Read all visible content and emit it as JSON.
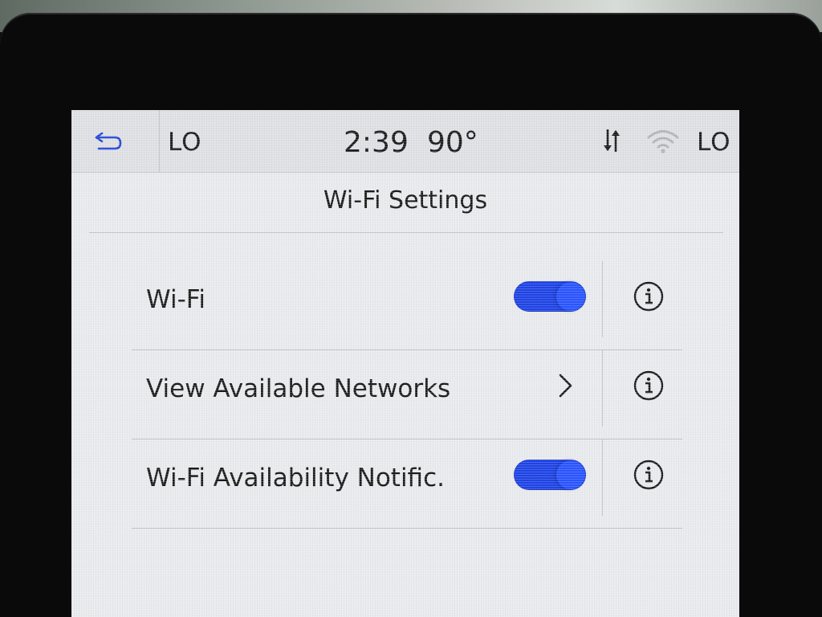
{
  "status_bar": {
    "back_icon": "back-arrow-icon",
    "left_temp": "LO",
    "time": "2:39",
    "outside_temp": "90°",
    "data_icon": "data-transfer-icon",
    "wifi_icon": "wifi-signal-icon",
    "right_temp": "LO"
  },
  "page": {
    "title": "Wi-Fi Settings"
  },
  "settings": [
    {
      "label": "Wi-Fi",
      "control": "toggle",
      "on": true,
      "info_icon": "info-icon"
    },
    {
      "label": "View Available Networks",
      "control": "chevron",
      "info_icon": "info-icon"
    },
    {
      "label": "Wi-Fi Availability Notific.",
      "control": "toggle",
      "on": true,
      "info_icon": "info-icon"
    }
  ],
  "colors": {
    "toggle_on": "#1f44e6",
    "screen_bg": "#e9ebee",
    "status_bar_bg": "#dfe1e4"
  }
}
